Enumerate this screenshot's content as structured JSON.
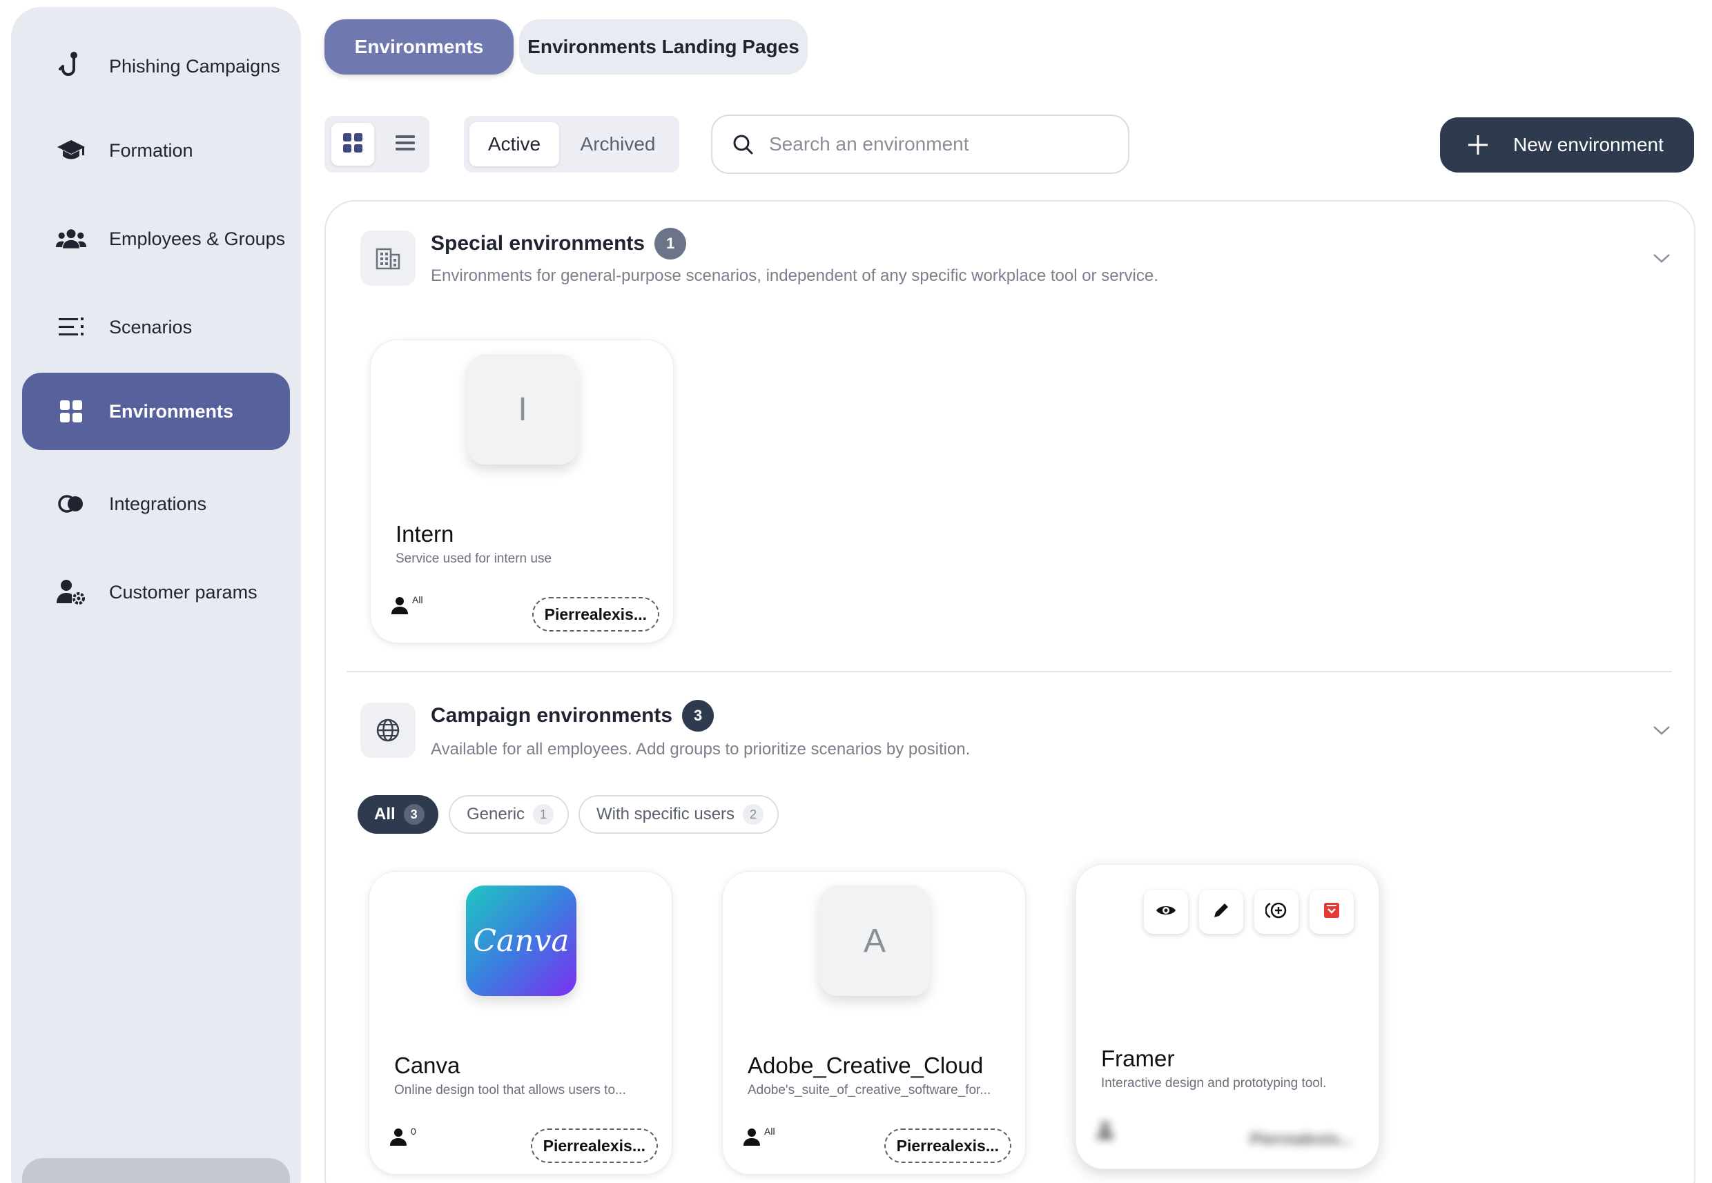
{
  "sidebar": {
    "items": [
      {
        "label": "Phishing Campaigns",
        "icon": "hook-icon"
      },
      {
        "label": "Formation",
        "icon": "graduation-cap-icon"
      },
      {
        "label": "Employees & Groups",
        "icon": "users-icon"
      },
      {
        "label": "Scenarios",
        "icon": "list-icon"
      },
      {
        "label": "Environments",
        "icon": "grid-icon",
        "active": true
      },
      {
        "label": "Integrations",
        "icon": "integrations-icon"
      },
      {
        "label": "Customer params",
        "icon": "user-settings-icon"
      }
    ]
  },
  "tabs": {
    "environments": "Environments",
    "landing_pages": "Environments Landing Pages"
  },
  "toolbar": {
    "status_active": "Active",
    "status_archived": "Archived",
    "search_placeholder": "Search an environment",
    "new_button": "New environment"
  },
  "special_section": {
    "title": "Special environments",
    "count": "1",
    "description": "Environments for general-purpose scenarios, independent of any specific workplace tool or service.",
    "cards": [
      {
        "logo_letter": "I",
        "name": "Intern",
        "description": "Service used for intern use",
        "users": "All",
        "owner": "Pierrealexis..."
      }
    ]
  },
  "campaign_section": {
    "title": "Campaign environments",
    "count": "3",
    "description": "Available for all employees. Add groups to prioritize scenarios by position.",
    "filters": [
      {
        "label": "All",
        "count": "3",
        "active": true
      },
      {
        "label": "Generic",
        "count": "1"
      },
      {
        "label": "With specific users",
        "count": "2"
      }
    ],
    "cards": [
      {
        "logo_text": "Canva",
        "name": "Canva",
        "description": "Online design tool that allows users to...",
        "users": "0",
        "owner": "Pierrealexis..."
      },
      {
        "logo_letter": "A",
        "name": "Adobe_Creative_Cloud",
        "description": "Adobe's_suite_of_creative_software_for...",
        "users": "All",
        "owner": "Pierrealexis..."
      },
      {
        "name": "Framer",
        "description": "Interactive design and prototyping tool.",
        "owner": "Pierrealexis..."
      }
    ]
  },
  "colors": {
    "accent": "#57629d",
    "dark": "#2e3b4e",
    "archive_red": "#e53935"
  }
}
